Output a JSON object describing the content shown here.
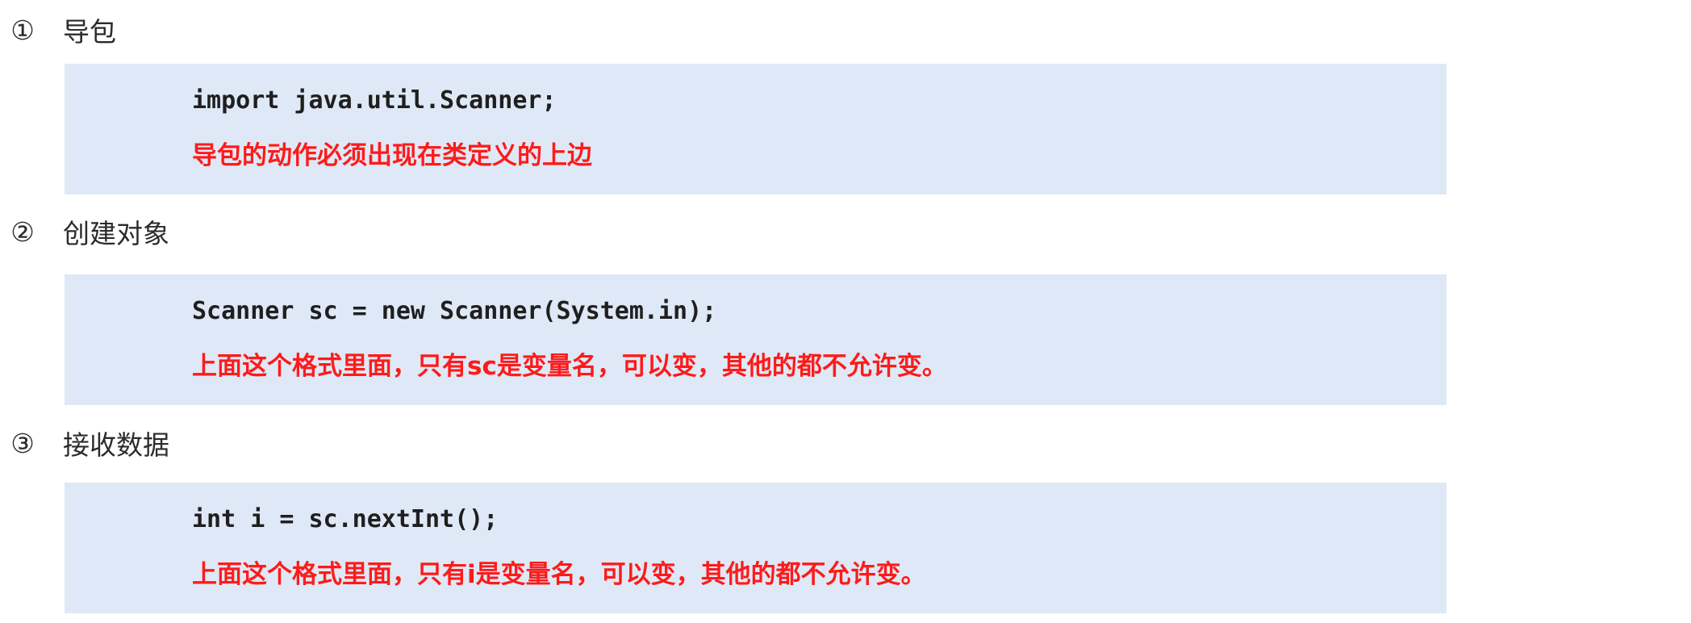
{
  "steps": [
    {
      "number": "①",
      "title": "导包",
      "code": "import java.util.Scanner;",
      "note": "导包的动作必须出现在类定义的上边"
    },
    {
      "number": "②",
      "title": "创建对象",
      "code": "Scanner sc = new Scanner(System.in);",
      "note": "上面这个格式里面，只有sc是变量名，可以变，其他的都不允许变。"
    },
    {
      "number": "③",
      "title": "接收数据",
      "code": "int i = sc.nextInt();",
      "note": "上面这个格式里面，只有i是变量名，可以变，其他的都不允许变。"
    }
  ],
  "colors": {
    "panel_background": "#dfe8f6",
    "note_text": "#ff1a1a",
    "code_text": "#1f1f1f"
  }
}
